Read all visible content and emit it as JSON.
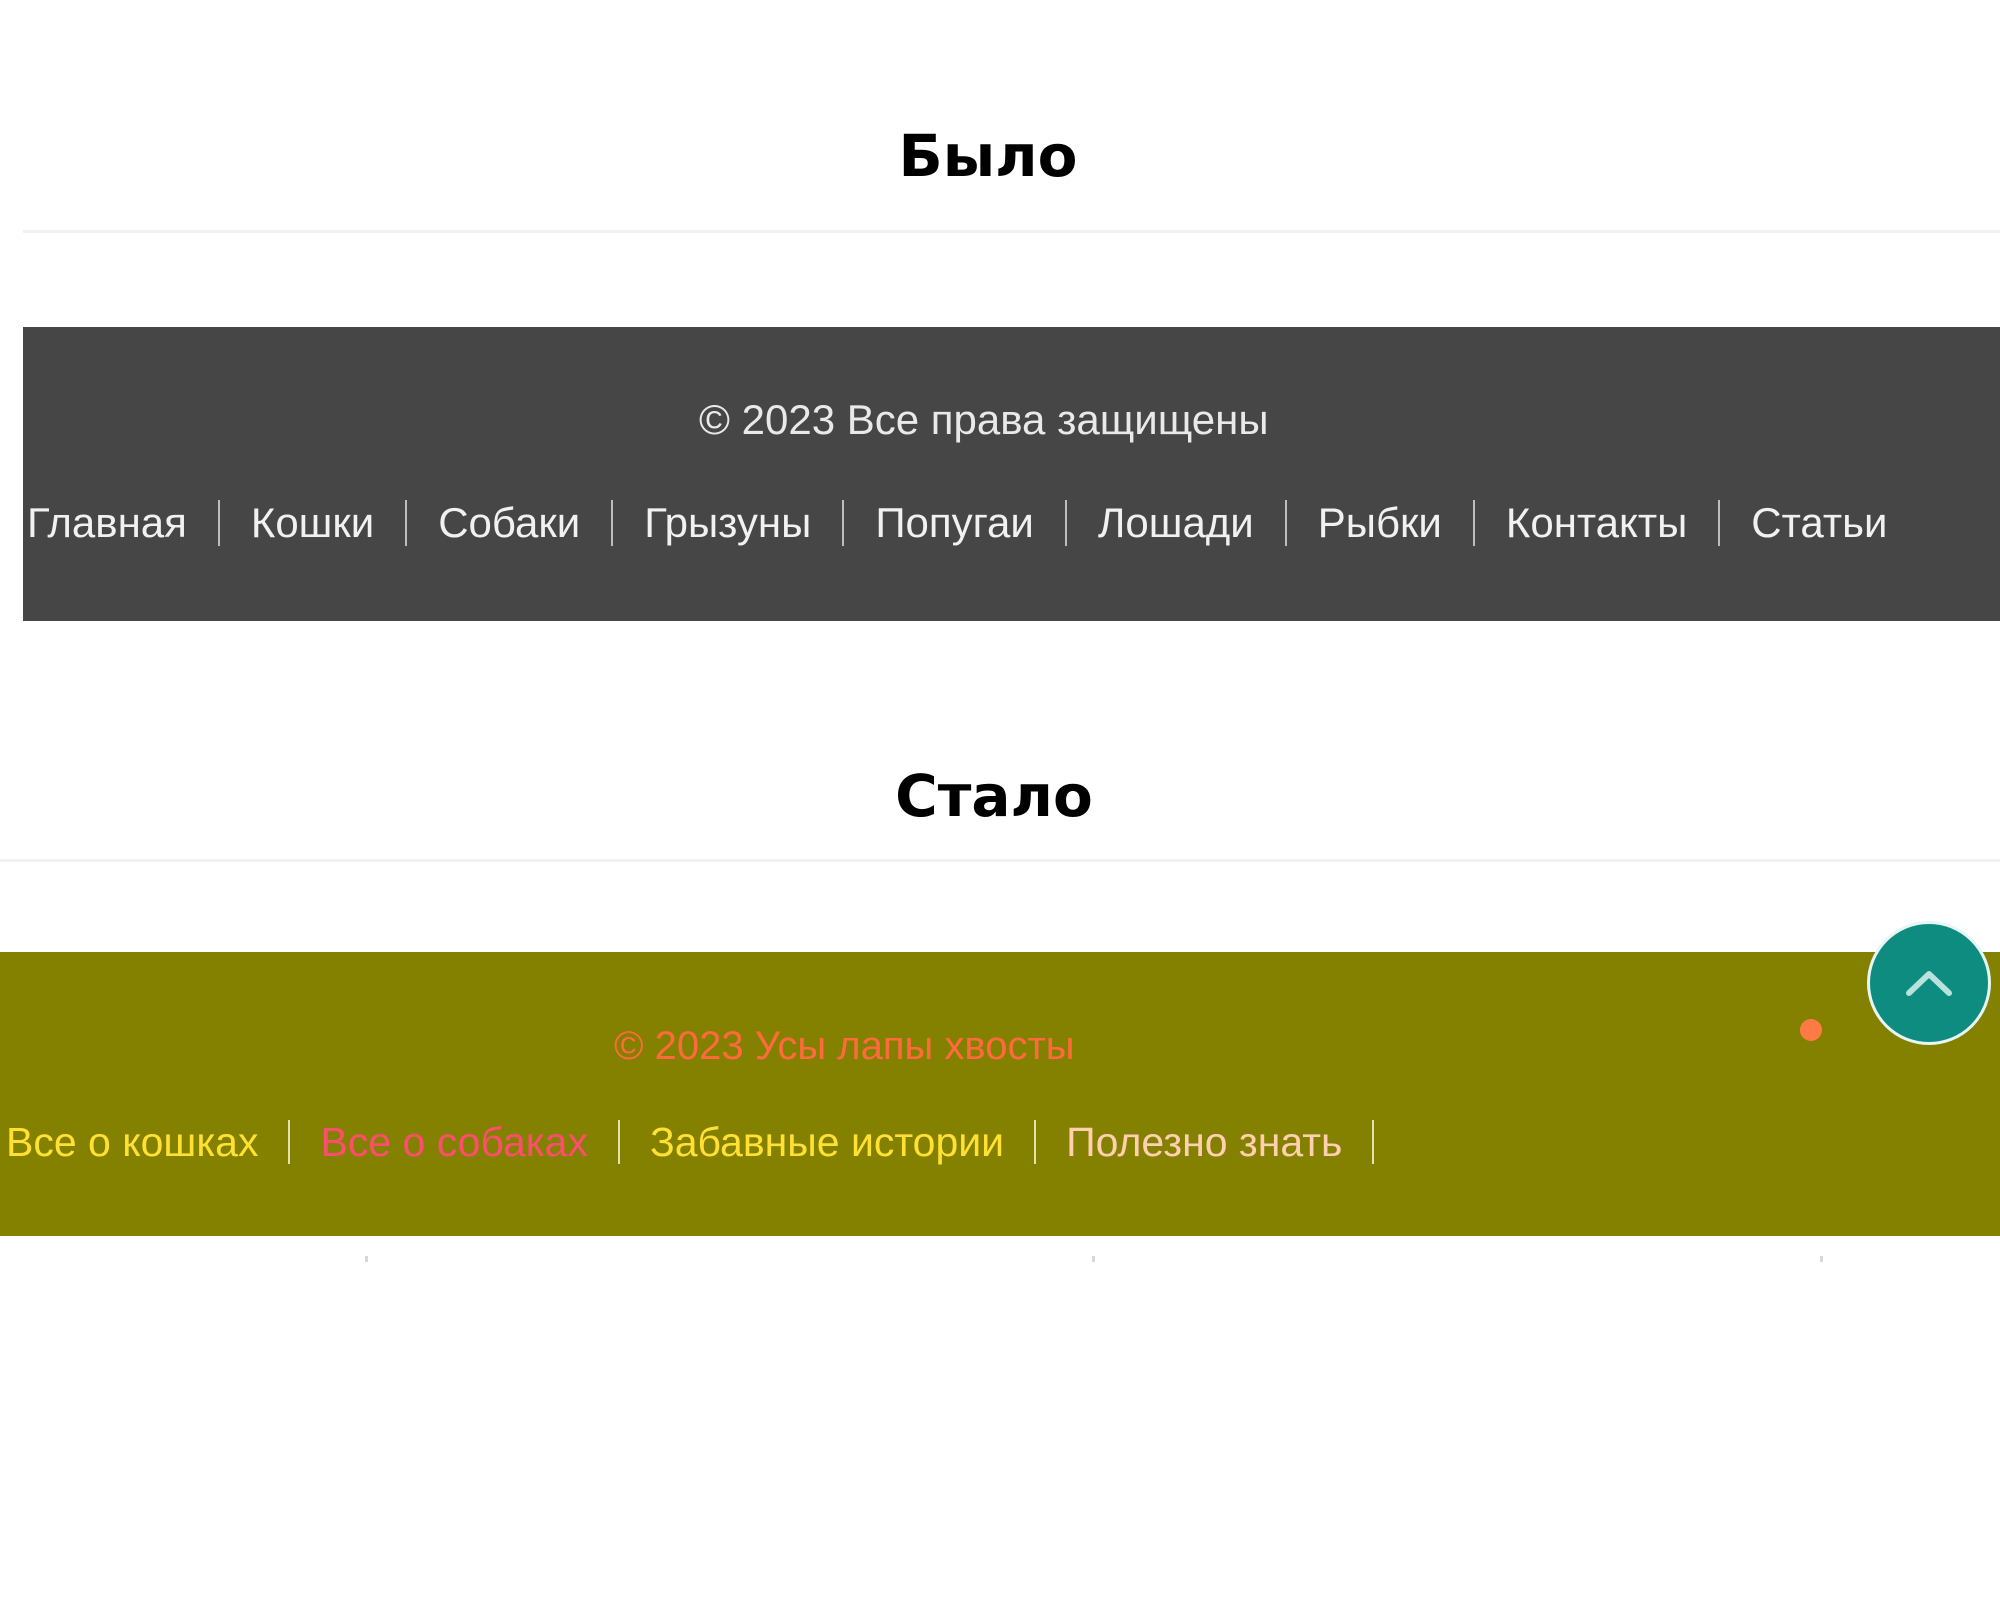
{
  "before": {
    "heading": "Было",
    "footer": {
      "background": "#464646",
      "copyright": "© 2023 Все права защищены",
      "nav": [
        {
          "label": "Главная"
        },
        {
          "label": "Кошки"
        },
        {
          "label": "Собаки"
        },
        {
          "label": "Грызуны"
        },
        {
          "label": "Попугаи"
        },
        {
          "label": "Лошади"
        },
        {
          "label": "Рыбки"
        },
        {
          "label": "Контакты"
        },
        {
          "label": "Статьи"
        }
      ]
    }
  },
  "after": {
    "heading": "Стало",
    "footer": {
      "background": "#848000",
      "copyright": "© 2023 Усы лапы хвосты",
      "copyright_color": "#ff6a3d",
      "nav": [
        {
          "label": "Все о кошках",
          "color": "#ffe033"
        },
        {
          "label": "Все о собаках",
          "color": "#ff4d6d"
        },
        {
          "label": "Забавные истории",
          "color": "#ffe033"
        },
        {
          "label": "Полезно знать",
          "color": "#ffd0b0"
        }
      ],
      "scroll_top_icon": "chevron-up-icon",
      "scroll_top_color": "#0e8c80",
      "indicator_color": "#ff7a45"
    }
  }
}
